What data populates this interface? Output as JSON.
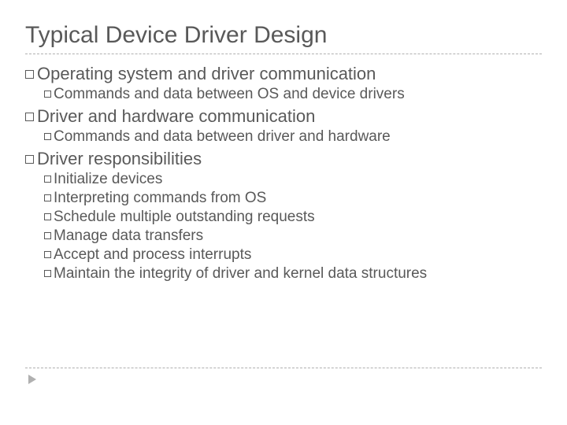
{
  "title": "Typical Device Driver Design",
  "b1": "Operating system and driver communication",
  "b1_1": "Commands and data between OS and device drivers",
  "b2": "Driver and hardware communication",
  "b2_1": "Commands and data between driver and hardware",
  "b3": "Driver responsibilities",
  "b3_1": "Initialize devices",
  "b3_2": "Interpreting commands from OS",
  "b3_3": "Schedule multiple outstanding requests",
  "b3_4": "Manage data transfers",
  "b3_5": "Accept and process interrupts",
  "b3_6": "Maintain the integrity of driver and kernel data structures"
}
